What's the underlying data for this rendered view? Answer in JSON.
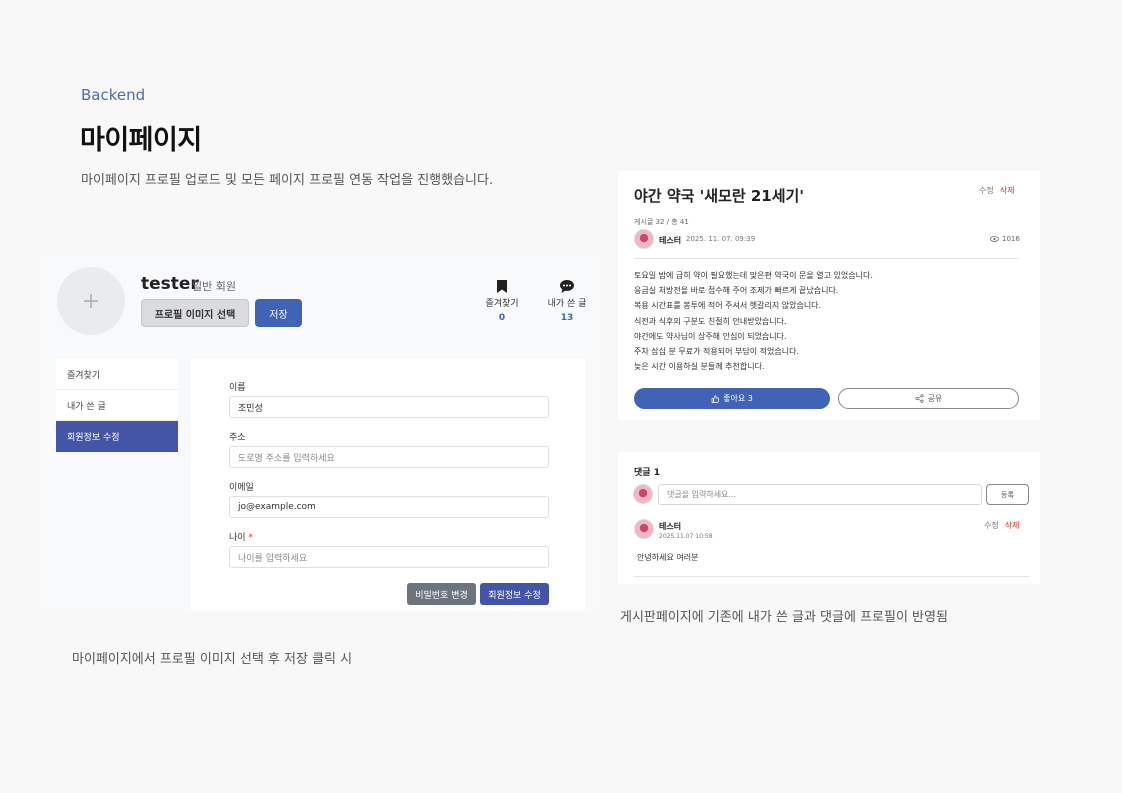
{
  "header": {
    "section_label": "Backend",
    "title": "마이페이지",
    "description": "마이페이지 프로필 업로드 및 모든 페이지 프로필 연동 작업을 진행했습니다."
  },
  "mypage": {
    "avatar_placeholder": "+",
    "username": "tester",
    "role": "일반 회원",
    "select_image_label": "프로필 이미지 선택",
    "save_label": "저장",
    "stats": [
      {
        "icon": "bookmark-icon",
        "label": "즐겨찾기",
        "count": "0"
      },
      {
        "icon": "comment-icon",
        "label": "내가 쓴 글",
        "count": "13"
      }
    ],
    "menu": [
      {
        "label": "즐겨찾기"
      },
      {
        "label": "내가 쓴 글"
      },
      {
        "label": "회원정보 수정",
        "active": true
      }
    ],
    "form": {
      "name_label": "이름",
      "name_value": "조민성",
      "address_label": "주소",
      "address_placeholder": "도로명 주소를 입력하세요",
      "email_label": "이메일",
      "email_value": "jo@example.com",
      "age_label": "나이",
      "age_required_mark": "*",
      "age_placeholder": "나이를 입력하세요",
      "change_password_label": "비밀번호 변경",
      "edit_info_label": "회원정보 수정"
    },
    "caption": "마이페이지에서 프로필 이미지 선택 후 저장 클릭 시"
  },
  "post": {
    "title": "야간 약국 '새모란 21세기'",
    "edit_label": "수정",
    "delete_label": "삭제",
    "meta": "게시글 32 / 총 41",
    "author": "테스터",
    "date": "2025. 11. 07. 09:39",
    "views": "1016",
    "body": [
      "토요일 밤에 급히 약이 필요했는데 맞은편 약국이 문을 열고 있었습니다.",
      "응급실 처방전을 바로 접수해 주어 조제가 빠르게 끝났습니다.",
      "복용 시간표를 봉투에 적어 주셔서 헷갈리지 않았습니다.",
      "식전과 식후의 구분도 친절히 안내받았습니다.",
      "야간에도 약사님이 상주해 안심이 되었습니다.",
      "주차 삼십 분 무료가 적용되어 부담이 적었습니다.",
      "늦은 시간 이용하실 분들께 추천합니다."
    ],
    "like_label": "좋아요 3",
    "share_label": "공유"
  },
  "comments": {
    "title": "댓글 1",
    "input_placeholder": "댓글을 입력하세요...",
    "submit_label": "등록",
    "items": [
      {
        "author": "테스터",
        "date": "2025.11.07 10:58",
        "text": "안녕하세요 여러분",
        "edit_label": "수정",
        "delete_label": "삭제"
      }
    ],
    "caption": "게시판페이지에 기존에 내가 쓴 글과 댓글에 프로필이 반영됨"
  },
  "colors": {
    "accent": "#3f63b6",
    "menu_active": "#4455a8",
    "danger": "#dd3333"
  }
}
